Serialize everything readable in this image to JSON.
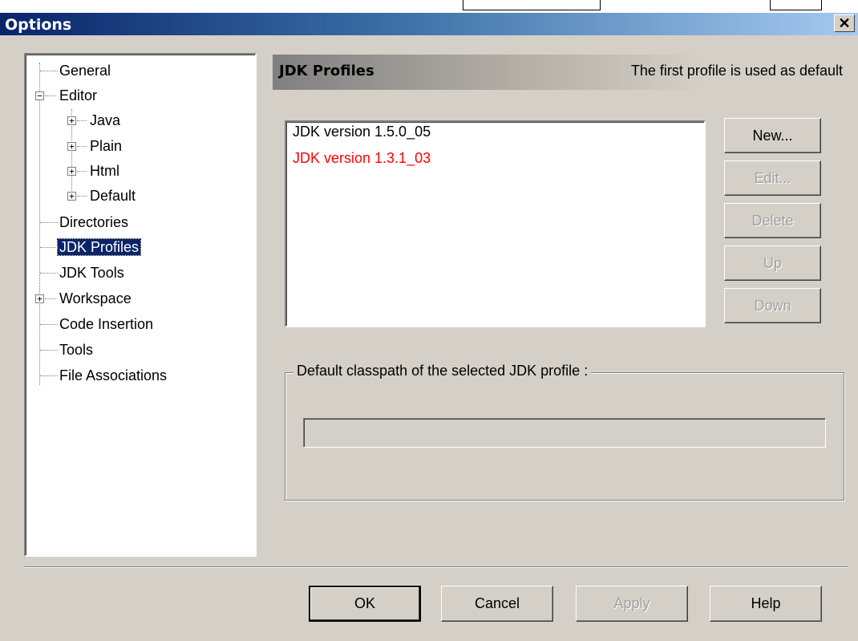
{
  "dialog": {
    "title": "Options",
    "close_symbol": "✕"
  },
  "tree": {
    "items": [
      {
        "label": "General"
      },
      {
        "label": "Editor",
        "expander": "−"
      },
      {
        "label": "Java",
        "expander": "+"
      },
      {
        "label": "Plain",
        "expander": "+"
      },
      {
        "label": "Html",
        "expander": "+"
      },
      {
        "label": "Default",
        "expander": "+"
      },
      {
        "label": "Directories"
      },
      {
        "label": "JDK Profiles",
        "selected": true
      },
      {
        "label": "JDK Tools"
      },
      {
        "label": "Workspace",
        "expander": "+"
      },
      {
        "label": "Code Insertion"
      },
      {
        "label": "Tools"
      },
      {
        "label": "File Associations"
      }
    ]
  },
  "section": {
    "title": "JDK Profiles",
    "note": "The first profile is used as default"
  },
  "profiles": {
    "items": [
      {
        "label": "JDK version 1.5.0_05",
        "color": "#000000"
      },
      {
        "label": "JDK version 1.3.1_03",
        "color": "#ff0000"
      }
    ]
  },
  "profile_buttons": {
    "new": "New...",
    "edit": "Edit...",
    "delete": "Delete",
    "up": "Up",
    "down": "Down"
  },
  "classpath": {
    "legend": "Default classpath of the selected JDK profile :",
    "value": ""
  },
  "footer": {
    "ok": "OK",
    "cancel": "Cancel",
    "apply": "Apply",
    "help": "Help"
  },
  "colors": {
    "titlebar_start": "#0a246a",
    "face": "#d4d0c8",
    "disabled_text": "#a0a0a0",
    "selection": "#0a246a"
  }
}
